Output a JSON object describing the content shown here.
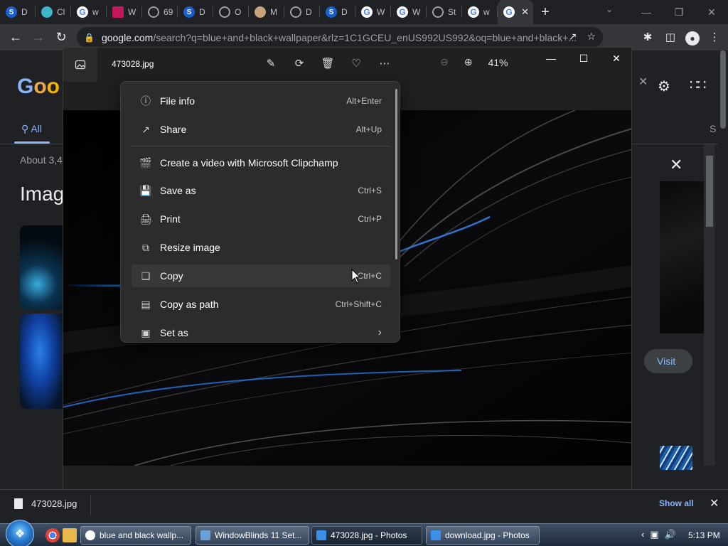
{
  "browser": {
    "tabs": [
      {
        "label": "D",
        "icon": "blue"
      },
      {
        "label": "Cl",
        "icon": "teal"
      },
      {
        "label": "w",
        "icon": "g"
      },
      {
        "label": "W",
        "icon": "mag"
      },
      {
        "label": "69",
        "icon": "globe"
      },
      {
        "label": "D",
        "icon": "blue"
      },
      {
        "label": "O",
        "icon": "globe"
      },
      {
        "label": "M",
        "icon": "tan"
      },
      {
        "label": "D",
        "icon": "globe"
      },
      {
        "label": "D",
        "icon": "blue"
      },
      {
        "label": "W",
        "icon": "g"
      },
      {
        "label": "W",
        "icon": "g"
      },
      {
        "label": "St",
        "icon": "globe"
      },
      {
        "label": "w",
        "icon": "g"
      }
    ],
    "active_tab_close": "✕",
    "new_tab": "+",
    "url_host": "google.com",
    "url_rest": "/search?q=blue+and+black+wallpaper&rlz=1C1GCEU_enUS992US992&oq=blue+and+black+..."
  },
  "google": {
    "tab_all": "All",
    "about": "About 3,4",
    "images_heading": "Imag",
    "right_tab": "S",
    "visit": "Visit"
  },
  "photos": {
    "filename": "473028.jpg",
    "zoom": "41%"
  },
  "menu": {
    "items": [
      {
        "label": "File info",
        "shortcut": "Alt+Enter",
        "icon": "info-icon"
      },
      {
        "label": "Share",
        "shortcut": "Alt+Up",
        "icon": "share-icon"
      },
      {
        "label": "Create a video with Microsoft Clipchamp",
        "shortcut": "",
        "icon": "clapperboard-icon"
      },
      {
        "label": "Save as",
        "shortcut": "Ctrl+S",
        "icon": "save-icon"
      },
      {
        "label": "Print",
        "shortcut": "Ctrl+P",
        "icon": "print-icon"
      },
      {
        "label": "Resize image",
        "shortcut": "",
        "icon": "resize-icon"
      },
      {
        "label": "Copy",
        "shortcut": "Ctrl+C",
        "icon": "copy-icon"
      },
      {
        "label": "Copy as path",
        "shortcut": "Ctrl+Shift+C",
        "icon": "copy-path-icon"
      },
      {
        "label": "Set as",
        "shortcut": "›",
        "icon": "set-as-icon"
      }
    ]
  },
  "downloads": {
    "file": "473028.jpg",
    "show_all": "Show all"
  },
  "taskbar": {
    "tasks": [
      {
        "label": "blue and black wallp..."
      },
      {
        "label": "WindowBlinds 11 Set..."
      },
      {
        "label": "473028.jpg - Photos"
      },
      {
        "label": "download.jpg - Photos"
      }
    ],
    "clock": "5:13 PM"
  }
}
